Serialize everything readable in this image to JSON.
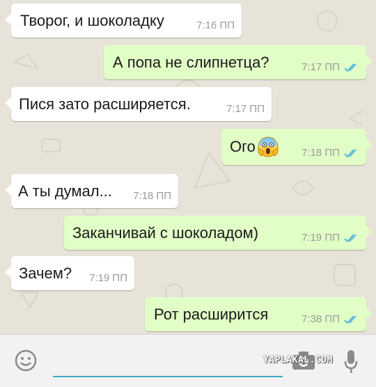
{
  "chat": {
    "messages": [
      {
        "direction": "incoming",
        "text": "Творог, и шоколадку",
        "time": "7:16 ПП"
      },
      {
        "direction": "outgoing",
        "text": "А попа не слипнетца?",
        "time": "7:17 ПП",
        "status": "read"
      },
      {
        "direction": "incoming",
        "text": "Пися зато расширяется.",
        "time": "7:17 ПП"
      },
      {
        "direction": "outgoing",
        "text": "Ого",
        "emoji": "screaming-face",
        "time": "7:18 ПП",
        "status": "read"
      },
      {
        "direction": "incoming",
        "text": "А ты думал...",
        "time": "7:18 ПП"
      },
      {
        "direction": "outgoing",
        "text": "Заканчивай с шоколадом)",
        "time": "7:19 ПП",
        "status": "read"
      },
      {
        "direction": "incoming",
        "text": "Зачем?",
        "time": "7:19 ПП"
      },
      {
        "direction": "outgoing",
        "text": "Рот расширится",
        "time": "7:38 ПП",
        "status": "read"
      }
    ]
  },
  "composer": {
    "message_value": "",
    "icons": [
      "smiley-icon",
      "camera-icon",
      "microphone-icon"
    ]
  },
  "watermark": "YAPLAKAL.COM",
  "colors": {
    "incoming_bubble": "#ffffff",
    "outgoing_bubble": "#e1fec6",
    "read_ticks": "#4fb0e0",
    "input_underline": "#3fa9c5"
  }
}
